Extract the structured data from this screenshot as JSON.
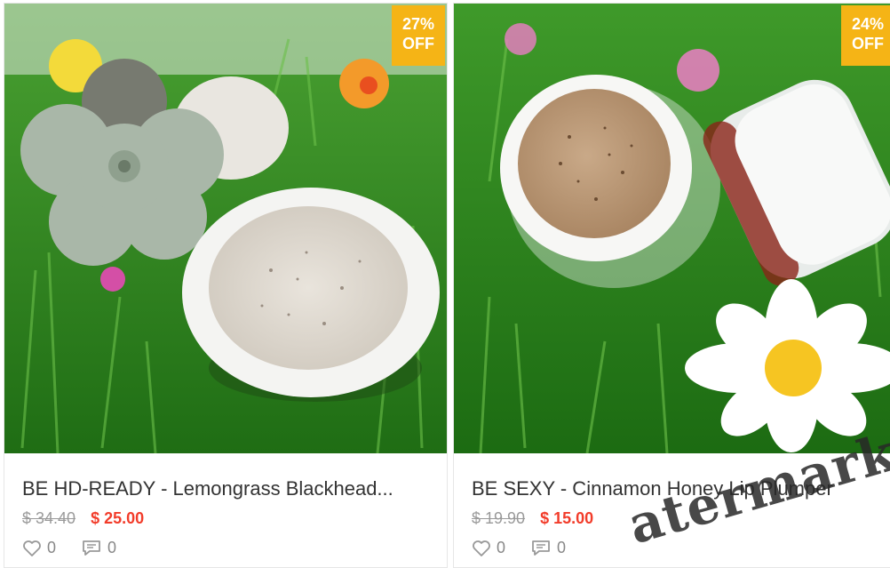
{
  "products": [
    {
      "discount_line1": "27%",
      "discount_line2": "OFF",
      "title": "BE HD-READY - Lemongrass Blackhead...",
      "old_price": "$ 34.40",
      "new_price": "$ 25.00",
      "likes": "0",
      "comments": "0"
    },
    {
      "discount_line1": "24%",
      "discount_line2": "OFF",
      "title": "BE SEXY - Cinnamon Honey Lip Plumper",
      "old_price": "$ 19.90",
      "new_price": "$ 15.00",
      "likes": "0",
      "comments": "0"
    }
  ],
  "watermark": "atermark",
  "colors": {
    "badge": "#f5b416",
    "price": "#f23c2a",
    "grass": "#2f8f1f"
  },
  "icons": [
    "heart-icon",
    "comment-icon"
  ]
}
